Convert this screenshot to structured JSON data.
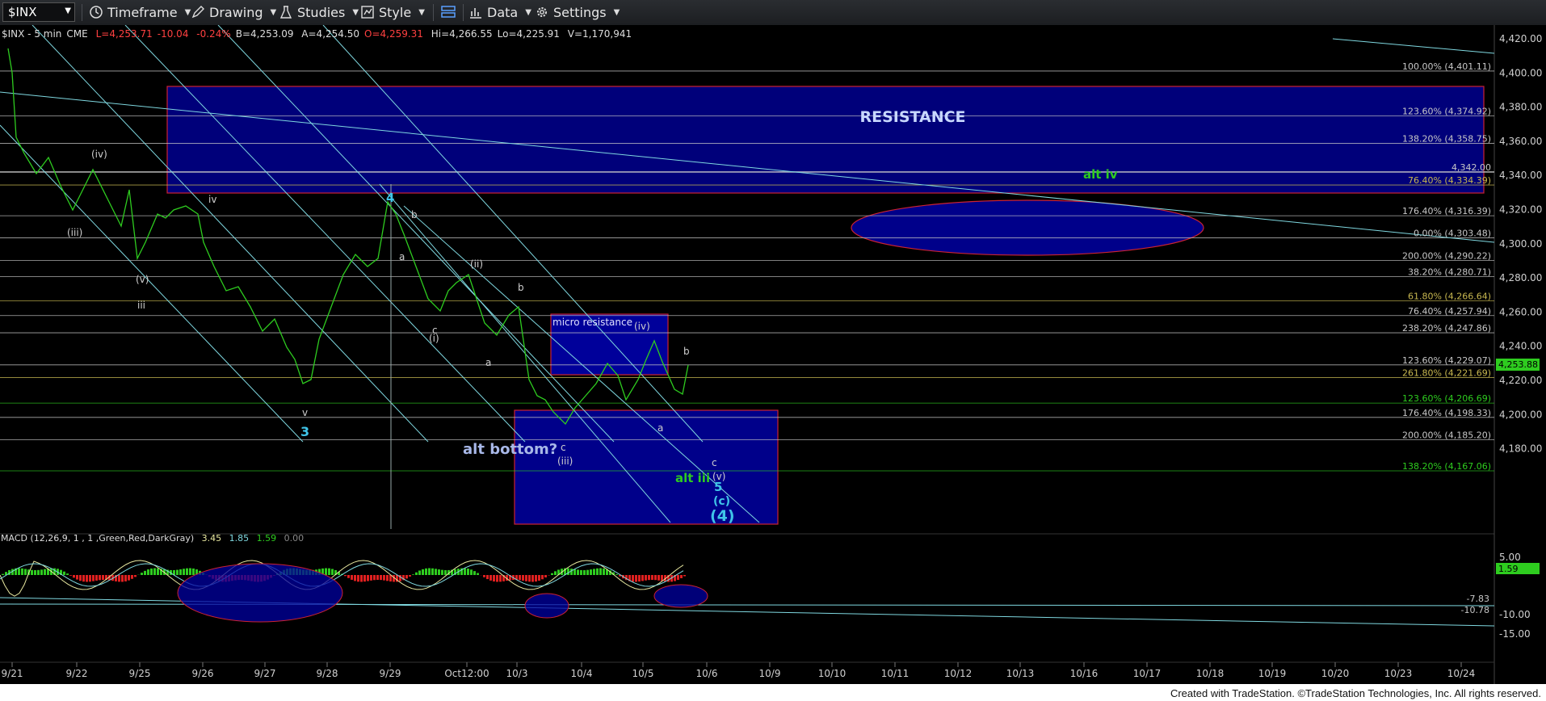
{
  "toolbar": {
    "symbol": "$INX",
    "timeframe": "Timeframe",
    "drawing": "Drawing",
    "studies": "Studies",
    "style": "Style",
    "data": "Data",
    "settings": "Settings"
  },
  "quote": {
    "symbol": "$INX - 5 min",
    "exchange": "CME",
    "last": "L=4,253.71",
    "change": "-10.04",
    "change_pct": "-0.24%",
    "bid": "B=4,253.09",
    "ask": "A=4,254.50",
    "open": "O=4,259.31",
    "high": "Hi=4,266.55",
    "low": "Lo=4,225.91",
    "volume": "V=1,170,941"
  },
  "price_axis": {
    "ticks": [
      "4,420.00",
      "4,400.00",
      "4,380.00",
      "4,360.00",
      "4,340.00",
      "4,320.00",
      "4,300.00",
      "4,280.00",
      "4,260.00",
      "4,240.00",
      "4,220.00",
      "4,200.00",
      "4,180.00"
    ],
    "current": "4,253.88"
  },
  "fib_labels": [
    "100.00% (4,401.11)",
    "123.60% (4,374.92)",
    "138.20% (4,358.75)",
    "4,342.00",
    "76.40% (4,334.39)",
    "176.40% (4,316.39)",
    "0.00% (4,303.48)",
    "200.00% (4,290.22)",
    "38.20% (4,280.71)",
    "61.80% (4,266.64)",
    "76.40% (4,257.94)",
    "238.20% (4,247.86)",
    "123.60% (4,229.07)",
    "261.80% (4,221.69)",
    "123.60% (4,206.69)",
    "176.40% (4,198.33)",
    "200.00% (4,185.20)",
    "138.20% (4,167.06)"
  ],
  "annotations": {
    "resistance": "RESISTANCE",
    "micro_resistance": "micro resistance",
    "alt_bottom": "alt bottom?",
    "alt_iv": "alt iv",
    "alt_iii": "alt iii",
    "wave_4": "4",
    "wave_3": "3",
    "wave_5": "5",
    "wave_4_paren": "(4)",
    "wave_c_paren": "(c)",
    "wave_v_paren": "(v)",
    "w_iv_paren": "(iv)",
    "w_iii_paren": "(iii)",
    "w_v_paren": "(v)",
    "w_iii": "iii",
    "w_iv": "iv",
    "w_v": "v",
    "w_ii_paren": "(ii)",
    "w_i_paren": "(i)",
    "w_a": "a",
    "w_b": "b",
    "w_c": "c"
  },
  "macd": {
    "title": "MACD (12,26,9, 1 , 1 ,Green,Red,DarkGray)",
    "v1": "3.45",
    "v2": "1.85",
    "v3": "1.59",
    "v4": "0.00",
    "axis": [
      "5.00",
      "-10.00",
      "-15.00"
    ],
    "marks": [
      "-7.83",
      "-10.78"
    ],
    "current": "1.59"
  },
  "time_axis": [
    "9/21",
    "9/22",
    "9/25",
    "9/26",
    "9/27",
    "9/28",
    "9/29",
    "Oct12:00",
    "10/3",
    "10/4",
    "10/5",
    "10/6",
    "10/9",
    "10/10",
    "10/11",
    "10/12",
    "10/13",
    "10/16",
    "10/17",
    "10/18",
    "10/19",
    "10/20",
    "10/23",
    "10/24"
  ],
  "footer": "Created with TradeStation. ©TradeStation Technologies, Inc. All rights reserved.",
  "colors": {
    "price": "#2ecc1f",
    "resistance_fill": "#00007a",
    "fib_line": "#c8c8c8",
    "channel": "#7fd8e0",
    "wave_label": "#3fc4e8",
    "up_label": "#2ecc1f"
  }
}
